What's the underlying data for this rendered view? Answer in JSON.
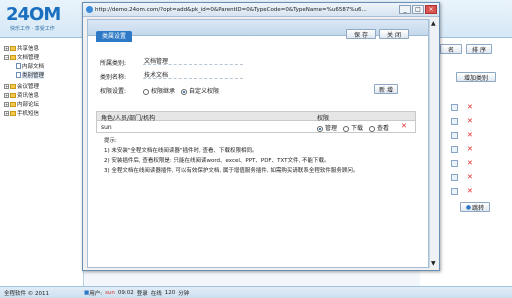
{
  "app": {
    "logo_main": "24OM",
    "logo_slogan": "快乐工作 · 享受工作",
    "tree": [
      {
        "label": "共享信息"
      },
      {
        "label": "文档管理"
      },
      {
        "label": "内部文档"
      },
      {
        "label": "类别管理"
      },
      {
        "label": "会议管理"
      },
      {
        "label": "资讯信息"
      },
      {
        "label": "内部论坛"
      },
      {
        "label": "手机短信"
      }
    ],
    "right_buttons": {
      "rename": "名",
      "sort": "排 序",
      "add_category": "增加类别"
    },
    "jump_label": "跳转",
    "status": {
      "copyright": "全程软件 © 2011",
      "user_prefix": "用户:",
      "user_name": "sun",
      "time": "09:02",
      "login": "登录",
      "online": "在线",
      "count": "120",
      "minutes": "分钟"
    }
  },
  "popup": {
    "url": "http://demo.24om.com/?opt=add&pk_id=0&ParentID=0&TypeCode=0&TypeName=%u6587%u6...",
    "save_label": "保 存",
    "close_label": "关 闭",
    "pane_title": "类属设置",
    "fields": {
      "category_label": "所属类别:",
      "category_value": "文档管理",
      "name_label": "类别名称:",
      "name_value": "技术文档",
      "perm_label": "权限设置:",
      "perm_inherit": "权限继承",
      "perm_custom": "自定义权限",
      "add_label": "新 增"
    },
    "table": {
      "col_role": "角色/人员/部门/机构",
      "col_perm": "权限",
      "row_name": "sun",
      "opt_manage": "管理",
      "opt_download": "下载",
      "opt_view": "查看"
    },
    "hints": [
      "提示:",
      "1) 未安装\"全程文档在线阅读器\"插件时, 查看、下载权限相同。",
      "2) 安装插件后, 查看权限是: 只能在线阅读word、excel、PPT、PDF、TXT文件, 不能下载。",
      "3) 全程文档在线阅读器插件, 可以有效保护文档, 属于增值服务插件, 如需购买请联系全程软件服务顾问。"
    ]
  }
}
